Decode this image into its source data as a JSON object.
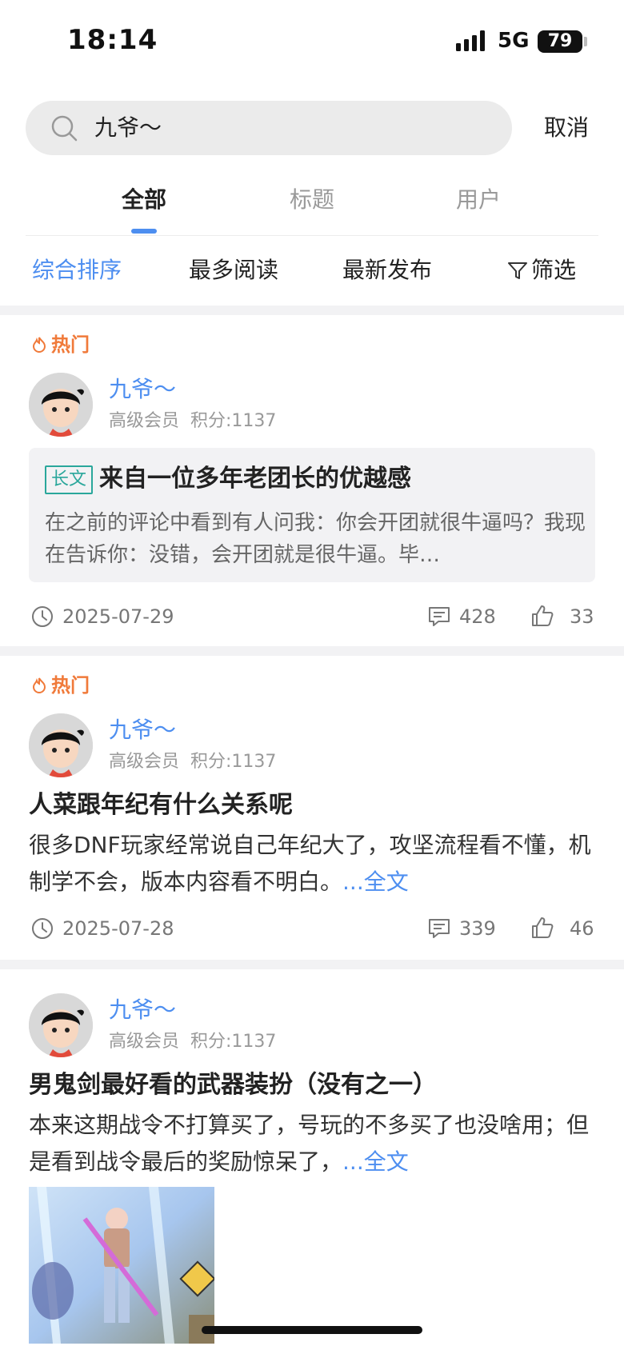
{
  "status_bar": {
    "time": "18:14",
    "network": "5G",
    "battery": "79"
  },
  "search": {
    "query": "九爷～",
    "cancel_label": "取消"
  },
  "tabs": [
    {
      "label": "全部",
      "active": true
    },
    {
      "label": "标题",
      "active": false
    },
    {
      "label": "用户",
      "active": false
    }
  ],
  "sort": {
    "items": [
      "综合排序",
      "最多阅读",
      "最新发布"
    ],
    "active_index": 0,
    "filter_label": "筛选"
  },
  "colors": {
    "accent": "#4d8ef0",
    "hot": "#f07a3a",
    "tag": "#2aa79b"
  },
  "posts": [
    {
      "hot_label": "热门",
      "user": {
        "name": "九爷～",
        "level": "高级会员",
        "points": "积分:1137"
      },
      "tag": "长文",
      "title": "来自一位多年老团长的优越感",
      "excerpt": "在之前的评论中看到有人问我：你会开团就很牛逼吗？我现在告诉你：没错，会开团就是很牛逼。毕…",
      "date": "2025-07-29",
      "comments": "428",
      "likes": "33"
    },
    {
      "hot_label": "热门",
      "user": {
        "name": "九爷～",
        "level": "高级会员",
        "points": "积分:1137"
      },
      "title": "人菜跟年纪有什么关系呢",
      "excerpt": "很多DNF玩家经常说自己年纪大了，攻坚流程看不懂，机制学不会，版本内容看不明白。",
      "more_label": "...全文",
      "date": "2025-07-28",
      "comments": "339",
      "likes": "46"
    },
    {
      "user": {
        "name": "九爷～",
        "level": "高级会员",
        "points": "积分:1137"
      },
      "title": "男鬼剑最好看的武器装扮（没有之一）",
      "excerpt": "本来这期战令不打算买了，号玩的不多买了也没啥用；但是看到战令最后的奖励惊呆了，",
      "more_label": "...全文",
      "image": "game-character-thumbnail"
    }
  ]
}
